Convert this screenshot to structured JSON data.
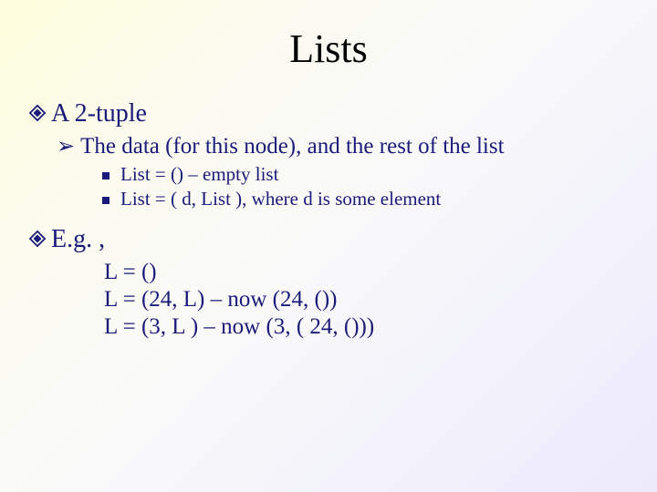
{
  "title": "Lists",
  "l1a": "A 2-tuple",
  "l2a": "The data (for this node), and the rest of the list",
  "l3a": "List = () – empty list",
  "l3b": "List = ( d, List ), where d is some element",
  "l1b": "E.g. ,",
  "pa": "L = ()",
  "pb": "L = (24, L) – now (24, ())",
  "pc": "L = (3, L ) – now (3, ( 24, ()))"
}
